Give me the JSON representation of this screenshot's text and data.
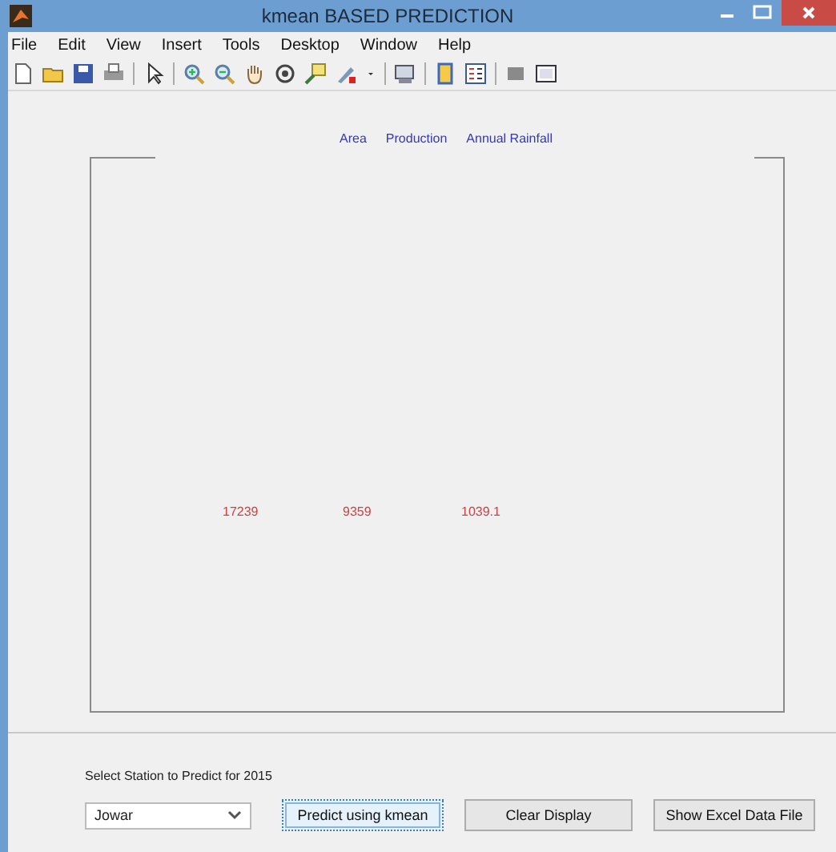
{
  "window": {
    "title": "kmean BASED PREDICTION"
  },
  "menu": [
    "File",
    "Edit",
    "View",
    "Insert",
    "Tools",
    "Desktop",
    "Window",
    "Help"
  ],
  "axes": {
    "headers": [
      "Area",
      "Production",
      "Annual Rainfall"
    ],
    "values": [
      "17239",
      "9359",
      "1039.1"
    ]
  },
  "controls": {
    "label": "Select Station to Predict for 2015",
    "dropdown": {
      "value": "Jowar"
    },
    "buttons": [
      {
        "label": "Predict using kmean",
        "focused": true
      },
      {
        "label": "Clear Display",
        "focused": false
      },
      {
        "label": "Show Excel Data File",
        "focused": false
      }
    ]
  }
}
